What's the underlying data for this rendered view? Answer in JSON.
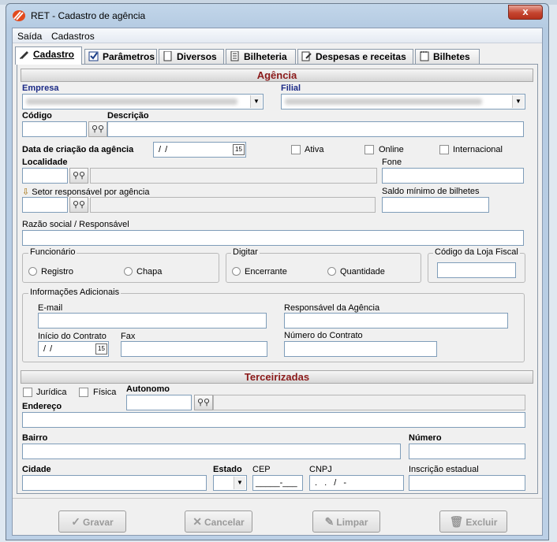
{
  "window": {
    "title": "RET - Cadastro de agência",
    "close_glyph": "x"
  },
  "menu": {
    "items": [
      "Saída",
      "Cadastros"
    ]
  },
  "tabs": [
    {
      "label": "Cadastro",
      "icon": "pencil-icon",
      "active": true
    },
    {
      "label": "Parâmetros",
      "icon": "checkbox-icon"
    },
    {
      "label": "Diversos",
      "icon": "document-icon"
    },
    {
      "label": "Bilheteria",
      "icon": "sheet-icon"
    },
    {
      "label": "Despesas e receitas",
      "icon": "edit-page-icon"
    },
    {
      "label": "Bilhetes",
      "icon": "notepad-icon"
    }
  ],
  "agencia": {
    "header": "Agência",
    "empresa_label": "Empresa",
    "filial_label": "Filial",
    "codigo_label": "Código",
    "descricao_label": "Descrição",
    "data_criacao_label": "Data de criação da agência",
    "data_criacao_value": "/ /",
    "ativa_label": "Ativa",
    "online_label": "Online",
    "internacional_label": "Internacional",
    "localidade_label": "Localidade",
    "fone_label": "Fone",
    "setor_label": "Setor responsável por agência",
    "saldo_label": "Saldo mínimo de bilhetes",
    "razao_label": "Razão social / Responsável",
    "funcionario_legend": "Funcionário",
    "registro_label": "Registro",
    "chapa_label": "Chapa",
    "digitar_legend": "Digitar",
    "encerrante_label": "Encerrante",
    "quantidade_label": "Quantidade",
    "codigo_loja_label": "Código da Loja Fiscal",
    "info_legend": "Informações Adicionais",
    "email_label": "E-mail",
    "responsavel_label": "Responsável da Agência",
    "inicio_label": "Início do Contrato",
    "inicio_value": "/ /",
    "fax_label": "Fax",
    "numero_contrato_label": "Número do Contrato"
  },
  "terceirizadas": {
    "header": "Terceirizadas",
    "juridica_label": "Jurídica",
    "fisica_label": "Física",
    "autonomo_label": "Autonomo",
    "endereco_label": "Endereço",
    "bairro_label": "Bairro",
    "numero_label": "Número",
    "cidade_label": "Cidade",
    "estado_label": "Estado",
    "cep_label": "CEP",
    "cep_value": "_____-___",
    "cnpj_label": "CNPJ",
    "cnpj_value": ". . / -",
    "inscricao_label": "Inscrição estadual"
  },
  "buttons": {
    "gravar": "Gravar",
    "cancelar": "Cancelar",
    "limpar": "Limpar",
    "excluir": "Excluir"
  }
}
